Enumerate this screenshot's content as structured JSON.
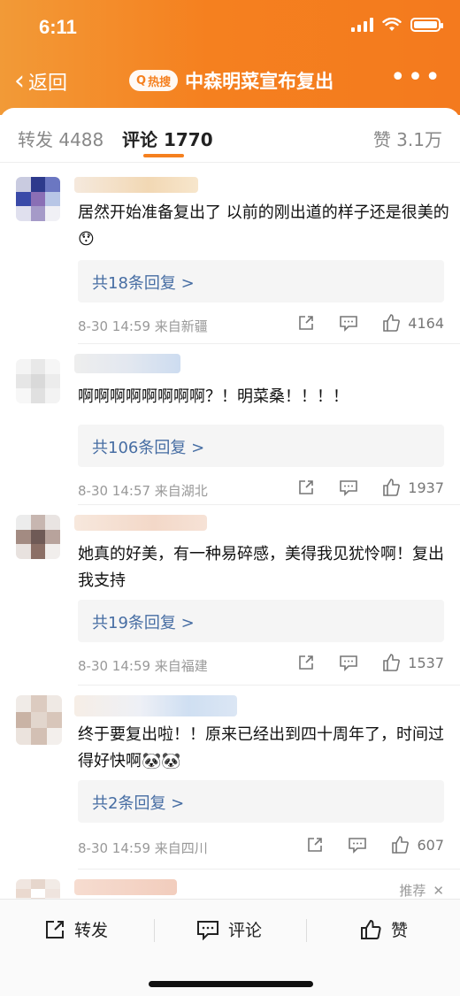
{
  "status_bar": {
    "time": "6:11"
  },
  "nav": {
    "back_label": "返回",
    "hot_badge": "热搜",
    "title": "中森明菜宣布复出",
    "more_label": "•••"
  },
  "tabs": {
    "repost": "转发 4488",
    "comment": "评论 1770",
    "likes": "赞 3.1万"
  },
  "comments": [
    {
      "text": "居然开始准备复出了 以前的刚出道的样子还是很美的😯",
      "replies": "共18条回复 >",
      "meta": "8-30 14:59  来自新疆",
      "likes": "4164"
    },
    {
      "text": "啊啊啊啊啊啊啊啊？！明菜桑！！！！",
      "replies": "共106条回复 >",
      "meta": "8-30 14:57  来自湖北",
      "likes": "1937"
    },
    {
      "text": "她真的好美，有一种易碎感，美得我见犹怜啊！复出我支持",
      "replies": "共19条回复 >",
      "meta": "8-30 14:59  来自福建",
      "likes": "1537"
    },
    {
      "text": "终于要复出啦！！原来已经出到四十周年了，时间过得好快啊🐼🐼",
      "replies": "共2条回复 >",
      "meta": "8-30 14:59  来自四川",
      "likes": "607"
    }
  ],
  "recommend": {
    "label": "推荐",
    "close": "✕"
  },
  "bottom_bar": {
    "repost": "转发",
    "comment": "评论",
    "like": "赞"
  }
}
